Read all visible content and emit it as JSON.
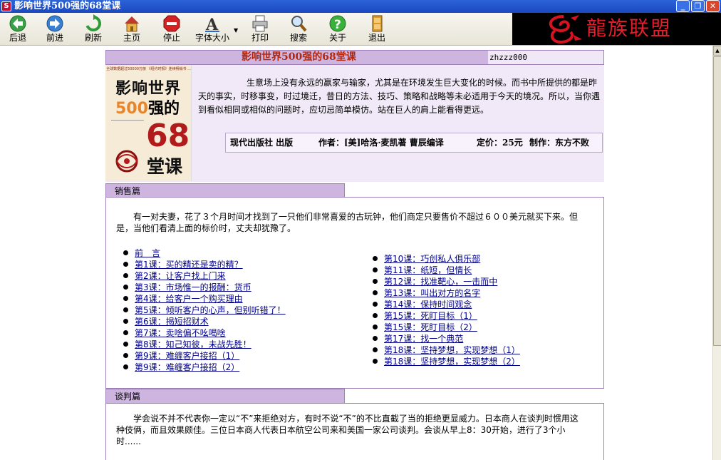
{
  "window": {
    "title": "影响世界500强的68堂课",
    "app_icon": "S"
  },
  "toolbar": {
    "back": "后退",
    "forward": "前进",
    "refresh": "刷新",
    "home": "主页",
    "stop": "停止",
    "font_size": "字体大小",
    "print": "打印",
    "search": "搜索",
    "about": "关于",
    "exit": "退出"
  },
  "banner": {
    "text": "龍族联盟"
  },
  "header": {
    "title": "影响世界500强的68堂课",
    "user": "zhzzz000"
  },
  "cover": {
    "top_text": "全球数据超过50000万册 《纽约时报》连续畅销书 ...",
    "line1": "影响世界",
    "line2_num": "500",
    "line2_text": "强的",
    "line3": "68",
    "line4": "堂课"
  },
  "intro": {
    "paragraph": "生意场上没有永远的赢家与输家，尤其是在环境发生巨大变化的时候。而书中所提供的都是昨天的事实，时移事变，时过境迁，昔日的方法、技巧、策略和战略等未必适用于今天的境况。所以，当你遇到看似相同或相似的问题时，应切忌简单模仿。站在巨人的肩上能看得更远。",
    "publisher": "现代出版社 出版",
    "author": "作者：[美]哈洛·麦凯著 曹辰编译",
    "price": "定价：25元",
    "maker": "制作：东方不败"
  },
  "sales": {
    "tab": "销售篇",
    "paragraph": "有一对夫妻，花了３个月时间才找到了一只他们非常喜爱的古玩钟，他们商定只要售价不超过６００美元就买下来。但是，当他们看清上面的标价时，丈夫却犹豫了。",
    "left_lessons": [
      "前　言",
      "第1课：买的精还是卖的精？",
      "第2课：让客户找上门来",
      "第3课：市场惟一的报酬：货币",
      "第4课：给客户一个购买理由",
      "第5课：倾听客户的心声，但别听错了！",
      "第6课：揭短招财术",
      "第7课：卖啥偏不吆喝啥",
      "第8课：知己知彼，未战先胜！",
      "第9课：难缠客户接招（1）",
      "第9课：难缠客户接招（2）"
    ],
    "right_lessons": [
      "第10课：巧创私人俱乐部",
      "第11课：纸短，但情长",
      "第12课：找准靶心，一击而中",
      "第13课：叫出对方的名字",
      "第14课：保持时间观念",
      "第15课：死盯目标（1）",
      "第15课：死盯目标（2）",
      "第17课：找一个典范",
      "第18课：坚持梦想，实现梦想（1）",
      "第18课：坚持梦想，实现梦想（2）"
    ]
  },
  "negotiation": {
    "tab": "谈判篇",
    "paragraph": "学会说不并不代表你一定以“不”来拒绝对方，有时不说“不”的不比直截了当的拒绝更显威力。日本商人在谈判时惯用这种伎俩，而且效果颇佳。三位日本商人代表日本航空公司来和美国一家公司谈判。会谈从早上8：30开始，进行了3个小时......"
  }
}
